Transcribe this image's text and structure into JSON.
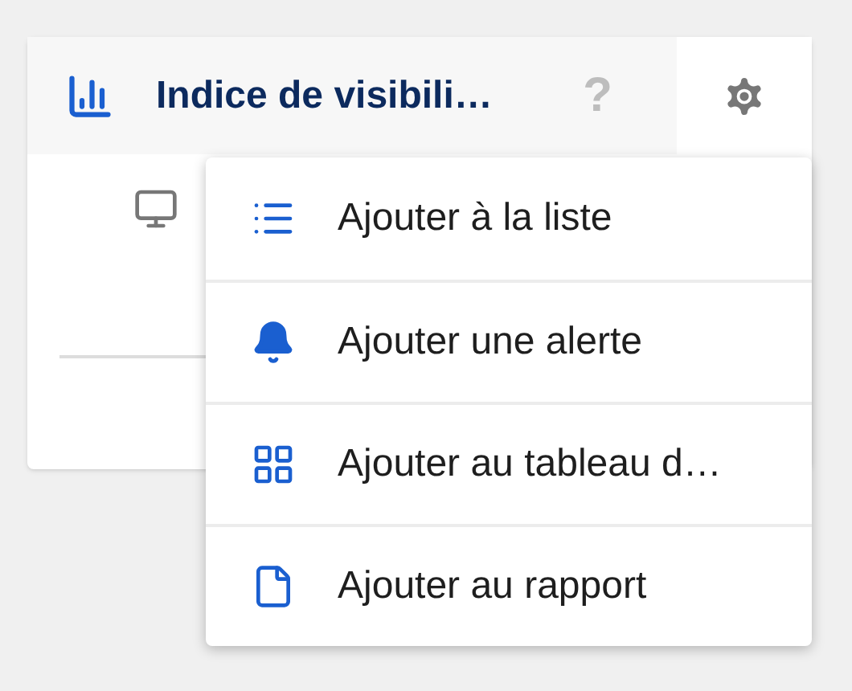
{
  "card": {
    "title": "Indice de visibili…",
    "help": "?"
  },
  "menu": {
    "items": [
      {
        "label": "Ajouter à la liste"
      },
      {
        "label": "Ajouter une alerte"
      },
      {
        "label": "Ajouter au tableau d…"
      },
      {
        "label": "Ajouter au rapport"
      }
    ]
  }
}
